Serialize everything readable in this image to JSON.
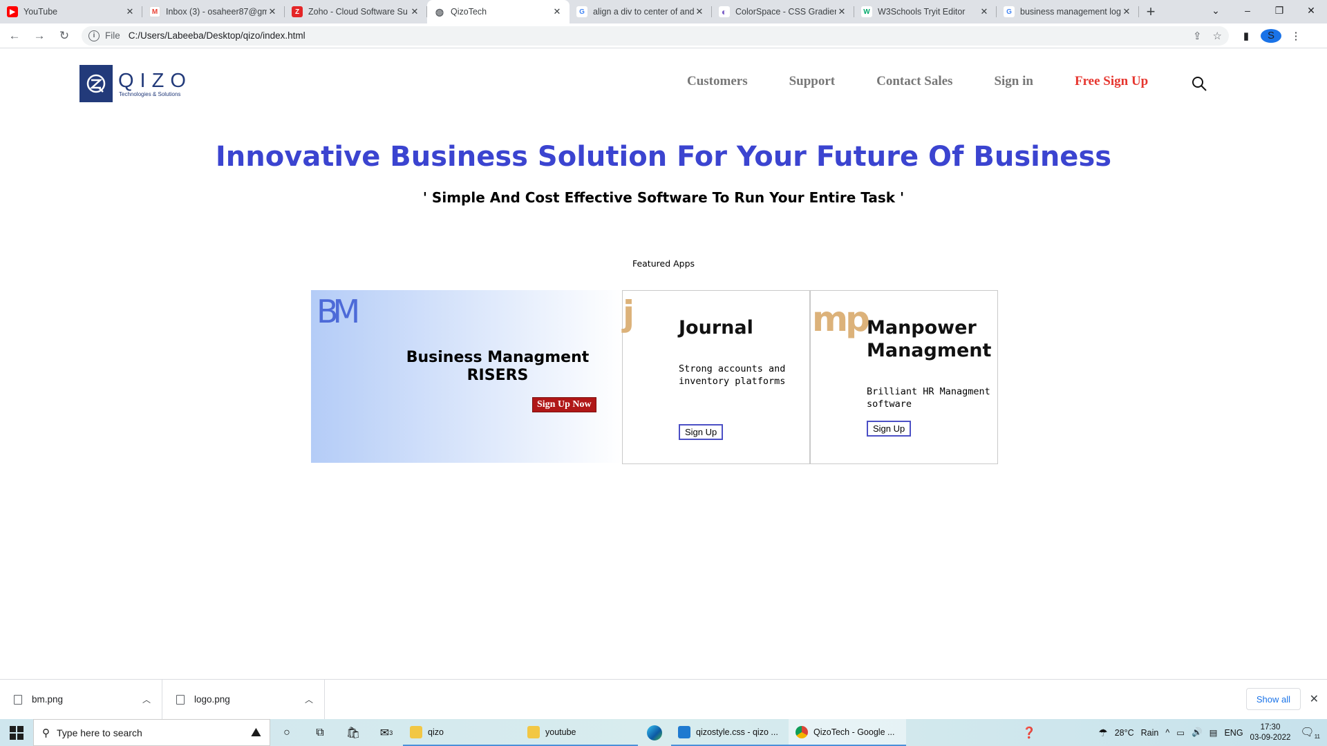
{
  "browser": {
    "tabs": [
      {
        "title": "YouTube",
        "icon": "youtube-icon",
        "color": "#ff0000",
        "glyph": "▶"
      },
      {
        "title": "Inbox (3) - osaheer87@gm",
        "icon": "gmail-icon",
        "color": "#ea4335",
        "glyph": "M"
      },
      {
        "title": "Zoho - Cloud Software Su",
        "icon": "zoho-icon",
        "color": "#e42527",
        "glyph": "Z"
      },
      {
        "title": "QizoTech",
        "icon": "globe-icon",
        "color": "#5f6368",
        "glyph": "◍"
      },
      {
        "title": "align a div to center of and",
        "icon": "google-icon",
        "color": "#4285f4",
        "glyph": "G"
      },
      {
        "title": "ColorSpace - CSS Gradient",
        "icon": "colorspace-icon",
        "color": "#7b5fc7",
        "glyph": "◐"
      },
      {
        "title": "W3Schools Tryit Editor",
        "icon": "w3schools-icon",
        "color": "#04aa6d",
        "glyph": "W"
      },
      {
        "title": "business management log",
        "icon": "google-icon",
        "color": "#4285f4",
        "glyph": "G"
      }
    ],
    "active_tab": 3,
    "new_tab": "+",
    "address": {
      "scheme": "File",
      "path": "C:/Users/Labeeba/Desktop/qizo/index.html"
    },
    "profile_initial": "S"
  },
  "site": {
    "logo": {
      "word": "QIZO",
      "tagline": "Technologies & Solutions"
    },
    "nav": [
      {
        "label": "Customers"
      },
      {
        "label": "Support"
      },
      {
        "label": "Contact Sales"
      },
      {
        "label": "Sign in"
      },
      {
        "label": "Free Sign Up"
      }
    ],
    "hero": {
      "title": "Innovative Business Solution For Your Future Of Business",
      "subtitle": "' Simple And Cost Effective Software To Run Your Entire Task '"
    },
    "featured_label": "Featured Apps",
    "cards": {
      "bm": {
        "logo": "BM",
        "title_line1": "Business Managment",
        "title_line2": "RISERS",
        "button": "Sign Up Now"
      },
      "journal": {
        "logo": "j",
        "title": "Journal",
        "desc": "Strong accounts and inventory platforms",
        "button": "Sign Up"
      },
      "manpower": {
        "logo": "mp",
        "title_line1": "Manpower",
        "title_line2": "Managment",
        "desc": "Brilliant HR Managment software",
        "button": "Sign Up"
      }
    },
    "colors": {
      "accent": "#3b44d0",
      "free_signup": "#e6362f",
      "brand": "#223a7a",
      "card_button_border": "#4b4fc5",
      "bm_button": "#b01717"
    }
  },
  "downloads": {
    "items": [
      {
        "name": "bm.png"
      },
      {
        "name": "logo.png"
      }
    ],
    "show_all": "Show all"
  },
  "taskbar": {
    "search_placeholder": "Type here to search",
    "apps": [
      {
        "label": "qizo"
      },
      {
        "label": "youtube"
      },
      {
        "label": "qizostyle.css - qizo ..."
      },
      {
        "label": "QizoTech - Google ..."
      }
    ],
    "mail_badge": "3",
    "weather": {
      "temp": "28°C",
      "condition": "Rain"
    },
    "language": "ENG",
    "time": "17:30",
    "date": "03-09-2022",
    "notification_count": "11"
  }
}
